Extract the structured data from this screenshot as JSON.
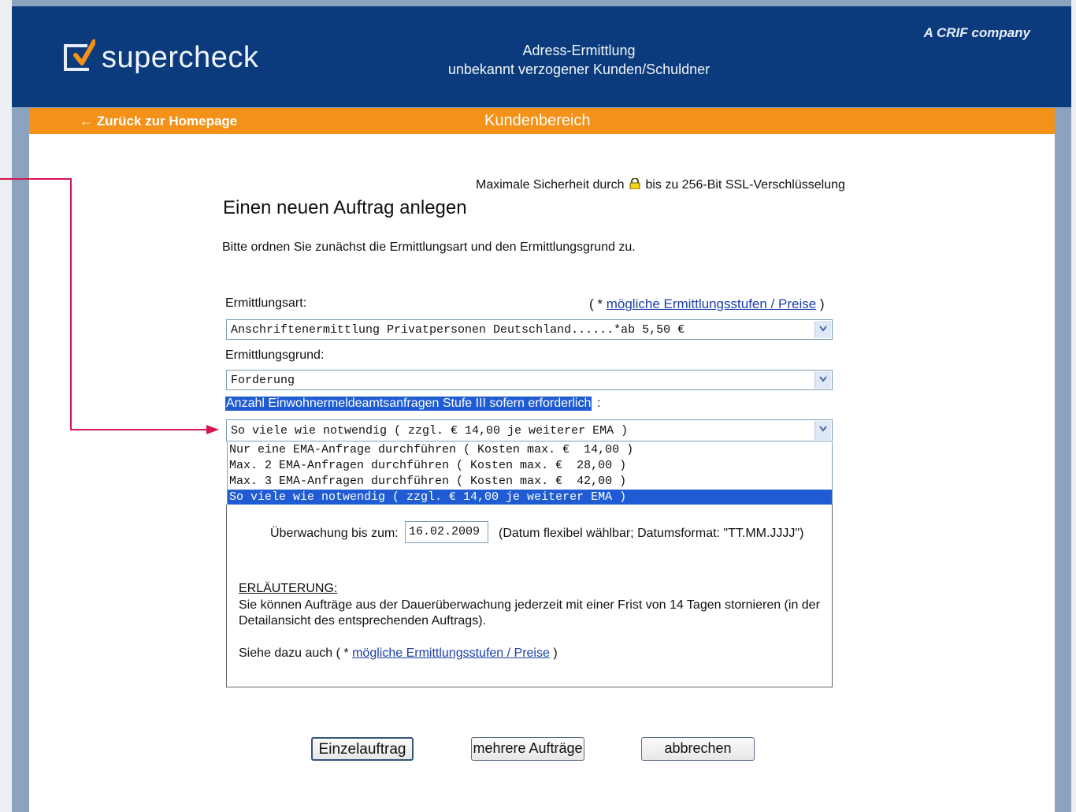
{
  "header": {
    "logo_text": "supercheck",
    "title_line1": "Adress-Ermittlung",
    "title_line2": "unbekannt verzogener Kunden/Schuldner",
    "crif_text": "A CRIF company"
  },
  "nav": {
    "back_label": "← Zurück zur Homepage",
    "section_label": "Kundenbereich"
  },
  "content": {
    "security_before": "Maximale Sicherheit durch",
    "security_after": "bis zu 256-Bit SSL-Verschlüsselung",
    "page_title": "Einen neuen Auftrag anlegen",
    "intro": "Bitte ordnen Sie zunächst die Ermittlungsart und den Ermittlungsgrund zu.",
    "ermittlungsart_label": "Ermittlungsart:",
    "hint_prefix": "( * ",
    "hint_link": "mögliche Ermittlungsstufen / Preise",
    "hint_suffix": " )",
    "ermittlungsart_value": "Anschriftenermittlung Privatpersonen Deutschland......*ab 5,50 €",
    "ermittlungsgrund_label": "Ermittlungsgrund:",
    "ermittlungsgrund_value": "Forderung",
    "ema_label": "Anzahl Einwohnermeldeamtsanfragen Stufe III sofern erforderlich",
    "ema_colon": ":",
    "ema_value": "So viele wie notwendig ( zzgl. € 14,00 je weiterer EMA )",
    "ema_options": [
      "Nur eine EMA-Anfrage durchführen ( Kosten max. €  14,00 )",
      "Max. 2 EMA-Anfragen durchführen ( Kosten max. €  28,00 )",
      "Max. 3 EMA-Anfragen durchführen ( Kosten max. €  42,00 )",
      "So viele wie notwendig ( zzgl. € 14,00 je weiterer EMA )"
    ],
    "monitor_label": "Überwachung bis zum:",
    "monitor_date": "16.02.2009",
    "monitor_hint": "(Datum flexibel wählbar; Datumsformat: \"TT.MM.JJJJ\")",
    "expl_title": "ERLÄUTERUNG:",
    "expl_body": "Sie können Aufträge aus der Dauerüberwachung jederzeit mit einer Frist von 14 Tagen stornieren (in der Detailansicht des entsprechenden Auftrags).",
    "see_also_prefix": "Siehe dazu auch ( * ",
    "see_also_link": "mögliche Ermittlungsstufen / Preise",
    "see_also_suffix": " )"
  },
  "buttons": {
    "single": "Einzelauftrag",
    "multiple": "mehrere Aufträge",
    "cancel": "abbrechen"
  },
  "colors": {
    "header_blue": "#0b3b7c",
    "orange": "#f39118",
    "selection_blue": "#1f5bd2",
    "annotation_arrow": "#d4164f"
  }
}
